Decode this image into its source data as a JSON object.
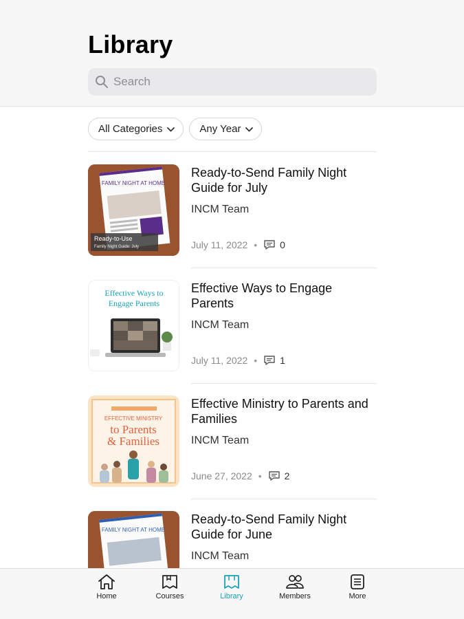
{
  "header": {
    "title": "Library",
    "search_placeholder": "Search"
  },
  "filters": [
    {
      "label": "All Categories"
    },
    {
      "label": "Any Year"
    }
  ],
  "items": [
    {
      "title": "Ready-to-Send Family Night Guide for July",
      "author": "INCM Team",
      "date": "July 11, 2022",
      "comments": "0",
      "thumb_title": "FAMILY NIGHT AT HOME",
      "thumb_caption": "Ready-to-Use",
      "thumb_subcaption": "Family Night Guide: July"
    },
    {
      "title": "Effective Ways to Engage Parents",
      "author": "INCM Team",
      "date": "July 11, 2022",
      "comments": "1",
      "thumb_title": "Effective Ways to Engage Parents"
    },
    {
      "title": "Effective Ministry to Parents and Families",
      "author": "INCM Team",
      "date": "June 27, 2022",
      "comments": "2",
      "thumb_kicker": "EFFECTIVE MINISTRY",
      "thumb_title_line1": "to Parents",
      "thumb_title_line2": "& Families"
    },
    {
      "title": "Ready-to-Send Family Night Guide for June",
      "author": "INCM Team",
      "date": "",
      "comments": "",
      "thumb_title": "FAMILY NIGHT AT HOME"
    }
  ],
  "tabs": [
    {
      "label": "Home",
      "icon": "home-icon"
    },
    {
      "label": "Courses",
      "icon": "courses-icon"
    },
    {
      "label": "Library",
      "icon": "library-icon",
      "active": true
    },
    {
      "label": "Members",
      "icon": "members-icon"
    },
    {
      "label": "More",
      "icon": "more-icon"
    }
  ],
  "colors": {
    "accent": "#1aa3b8",
    "header_bg": "#f7f7f7",
    "search_bg": "#e9e9eb"
  }
}
